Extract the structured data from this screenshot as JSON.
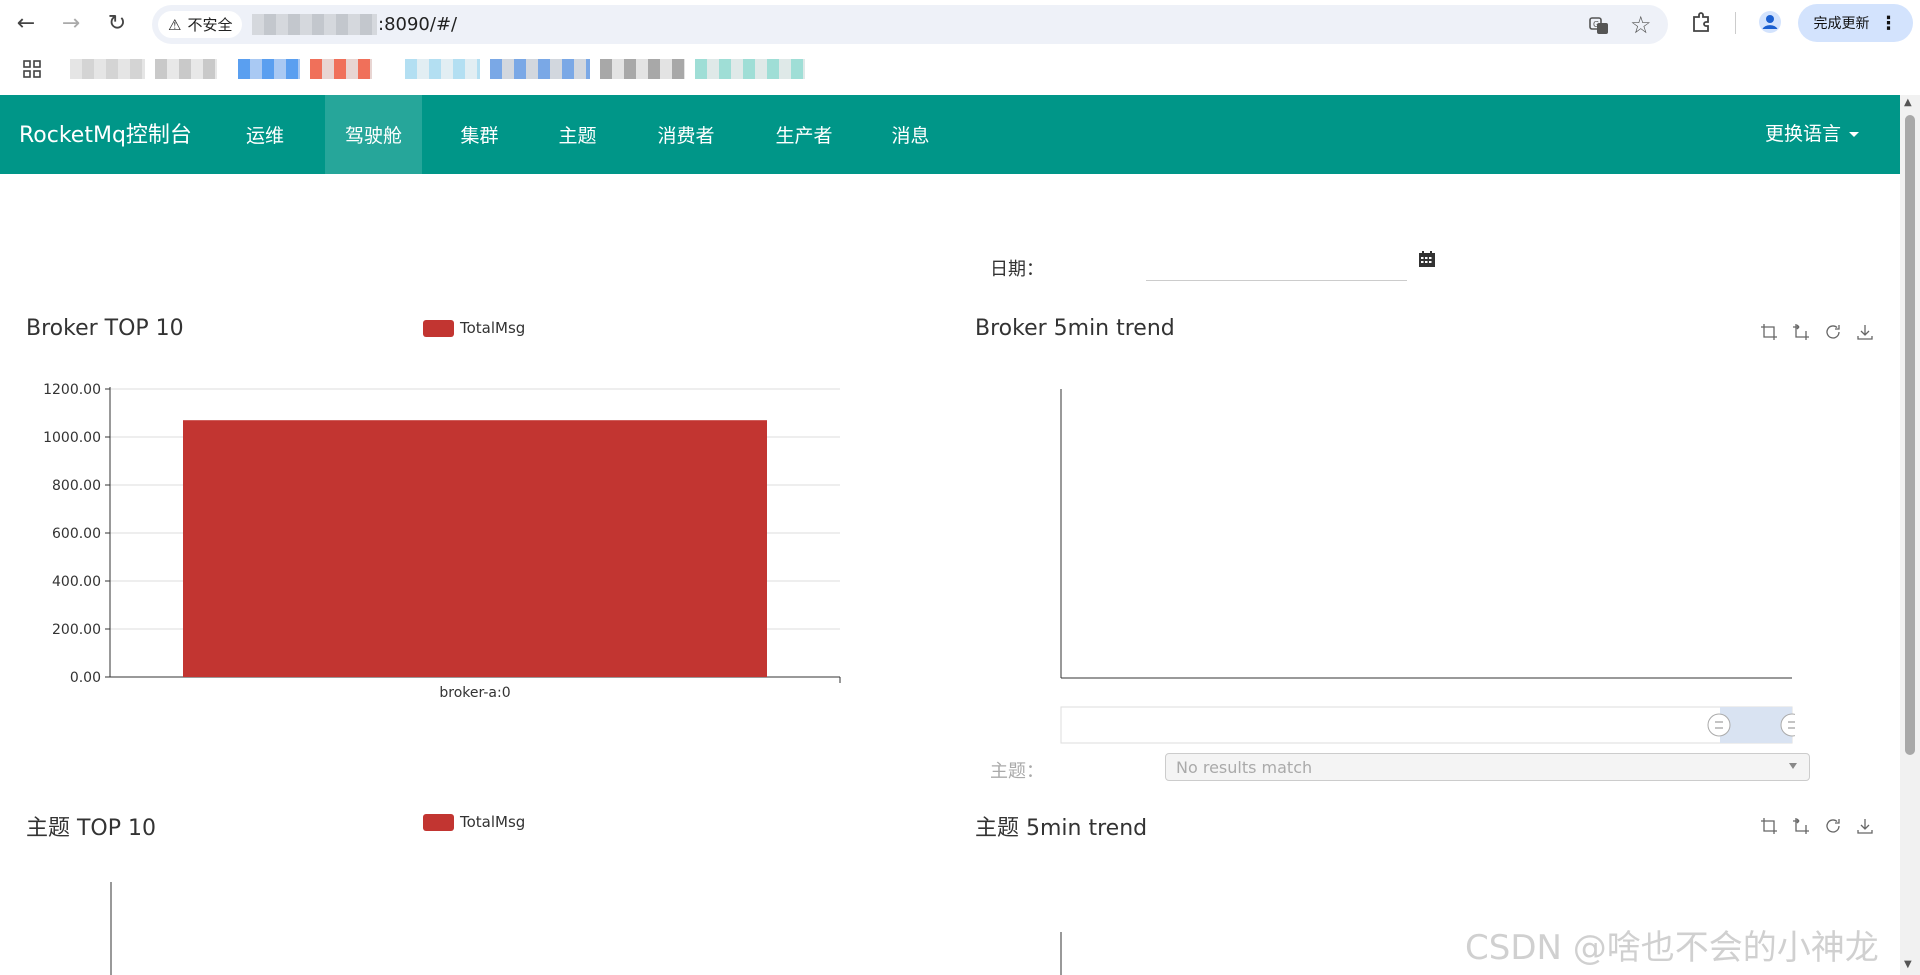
{
  "browser": {
    "back_icon": "←",
    "forward_icon": "→",
    "reload_icon": "↻",
    "security_icon": "⚠",
    "security_label": "不安全",
    "url_suffix": ":8090/#/",
    "translate_icon": "translate-icon",
    "star_icon": "☆",
    "extensions_icon": "extensions-icon",
    "profile_icon": "profile-icon",
    "update_label": "完成更新",
    "menu_icon": "⋮",
    "apps_icon": "apps-grid-icon"
  },
  "app": {
    "brand": "RocketMq控制台",
    "nav": [
      {
        "label": "运维",
        "active": false
      },
      {
        "label": "驾驶舱",
        "active": true
      },
      {
        "label": "集群",
        "active": false
      },
      {
        "label": "主题",
        "active": false
      },
      {
        "label": "消费者",
        "active": false
      },
      {
        "label": "生产者",
        "active": false
      },
      {
        "label": "消息",
        "active": false
      }
    ],
    "language_label": "更换语言",
    "accent_color": "#009688",
    "active_nav_color": "#26a69a"
  },
  "dashboard": {
    "date_label": "日期：",
    "date_value": "",
    "broker_top_title": "Broker TOP 10",
    "broker_trend_title": "Broker 5min trend",
    "topic_top_title": "主题 TOP 10",
    "topic_trend_title": "主题 5min trend",
    "legend_label": "TotalMsg",
    "topic_label": "主题：",
    "topic_select_placeholder": "No results match",
    "series_color": "#c23531"
  },
  "chart_data": [
    {
      "type": "bar",
      "title": "Broker TOP 10",
      "categories": [
        "broker-a:0"
      ],
      "series": [
        {
          "name": "TotalMsg",
          "values": [
            1070
          ]
        }
      ],
      "yticks": [
        "0.00",
        "200.00",
        "400.00",
        "600.00",
        "800.00",
        "1000.00",
        "1200.00"
      ],
      "ylim": [
        0,
        1200
      ],
      "grid": true,
      "legend": "top-center"
    },
    {
      "type": "line",
      "title": "Broker 5min trend",
      "series": [],
      "grid": false,
      "has_datazoom": true
    },
    {
      "type": "bar",
      "title": "主题 TOP 10",
      "series": [
        {
          "name": "TotalMsg",
          "values": []
        }
      ],
      "legend": "top-center"
    },
    {
      "type": "line",
      "title": "主题 5min trend",
      "series": []
    }
  ],
  "watermark": "CSDN @啥也不会的小神龙"
}
